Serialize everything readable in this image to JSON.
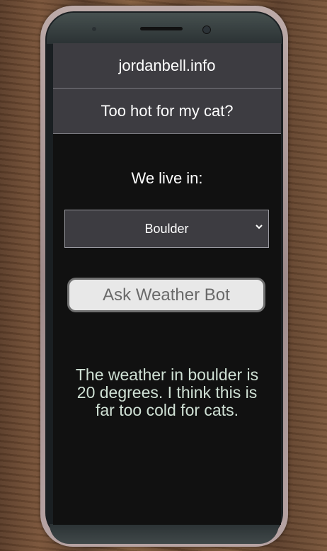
{
  "app": {
    "site_title": "jordanbell.info",
    "page_heading": "Too hot for my cat?"
  },
  "form": {
    "location_label": "We live in:",
    "location_selected": "Boulder",
    "ask_button_label": "Ask Weather Bot"
  },
  "result": {
    "message": "The weather in boulder is 20 degrees. I think this is far too cold for cats."
  },
  "colors": {
    "header_bg": "#3d3c41",
    "screen_bg": "#111111",
    "result_text": "#cfe0d4",
    "button_bg": "#e8e8e8"
  },
  "icons": {
    "select_arrow": "chevron-down-icon"
  }
}
